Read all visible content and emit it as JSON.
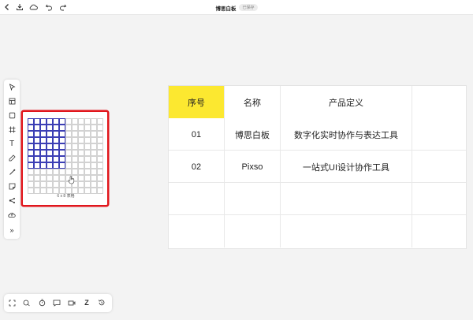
{
  "app": {
    "doc_title": "博思白板",
    "save_status": "已保存"
  },
  "topbar": {
    "icons": [
      "back-icon",
      "download-icon",
      "cloud-icon",
      "undo-icon",
      "redo-icon"
    ]
  },
  "left_toolbar": {
    "icons": [
      "cursor-icon",
      "table-icon",
      "rectangle-icon",
      "frame-icon",
      "text-icon",
      "pen-icon",
      "connector-icon",
      "sticky-note-icon",
      "mindmap-icon",
      "upload-icon",
      "more-icon"
    ],
    "text_tool_glyph": "T",
    "more_glyph": "»"
  },
  "table_picker": {
    "label": "6 x 8 表格",
    "grid_cols": 12,
    "grid_rows": 12,
    "selected_cols": 6,
    "selected_rows": 8
  },
  "table": {
    "headers": [
      "序号",
      "名称",
      "产品定义"
    ],
    "rows": [
      [
        "01",
        "博思白板",
        "数字化实时协作与表达工具"
      ],
      [
        "02",
        "Pixso",
        "一站式UI设计协作工具"
      ],
      [
        "",
        "",
        ""
      ],
      [
        "",
        "",
        ""
      ]
    ],
    "header_highlight_color": "#fce830"
  },
  "bottom_toolbar": {
    "icons": [
      "fit-screen-icon",
      "comment-icon",
      "timer-icon",
      "chat-icon",
      "video-icon",
      "z-icon",
      "history-icon"
    ],
    "z_glyph": "Z"
  },
  "colors": {
    "accent_border": "#e1161c",
    "grid_selected": "#3c3fb5"
  }
}
